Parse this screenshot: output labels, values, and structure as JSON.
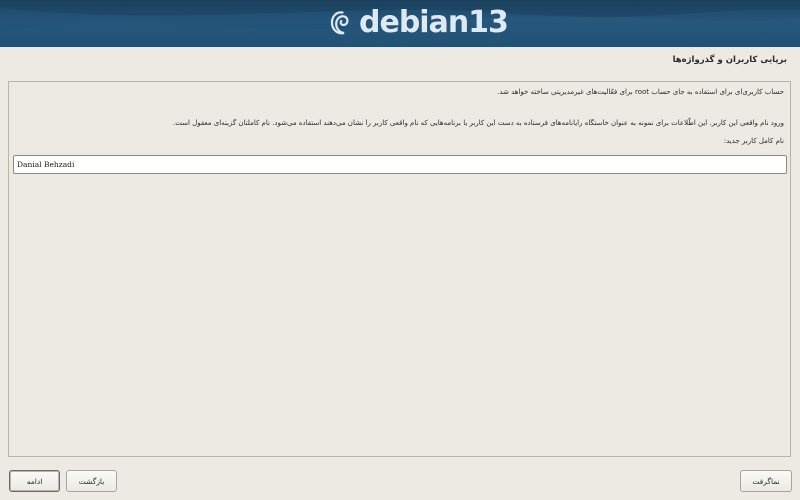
{
  "header": {
    "brand_text": "debian13",
    "logo_icon": "debian-swirl-icon",
    "colors": {
      "banner_dark": "#1f4766",
      "banner_mid": "#24557a",
      "brand_text": "#dfe9f2"
    }
  },
  "step": {
    "title": "برپایی کاربران و گذرواژه‌ها"
  },
  "main": {
    "paragraph_1": "حساب کاربری‌ای برای استفاده به جای حساب root برای فعّالیت‌های غیرمدیریتی ساخته خواهد شد.",
    "paragraph_2": "ورود نام واقعی این کاربر. این اطّلاعات برای نمونه به عنوان خاستگاه رایانامه‌های فرستاده به دست این کاربر یا برنامه‌هایی که نام واقعی کاربر را نشان می‌دهند استفاده می‌شود. نام کاملتان گزینه‌ای معقول است.",
    "field_label": "نام کامل کاربر جدید:",
    "full_name_value": "Danial Behzadi"
  },
  "buttons": {
    "continue": "ادامه",
    "back": "بازگشت",
    "screenshot": "نماگرفت"
  }
}
